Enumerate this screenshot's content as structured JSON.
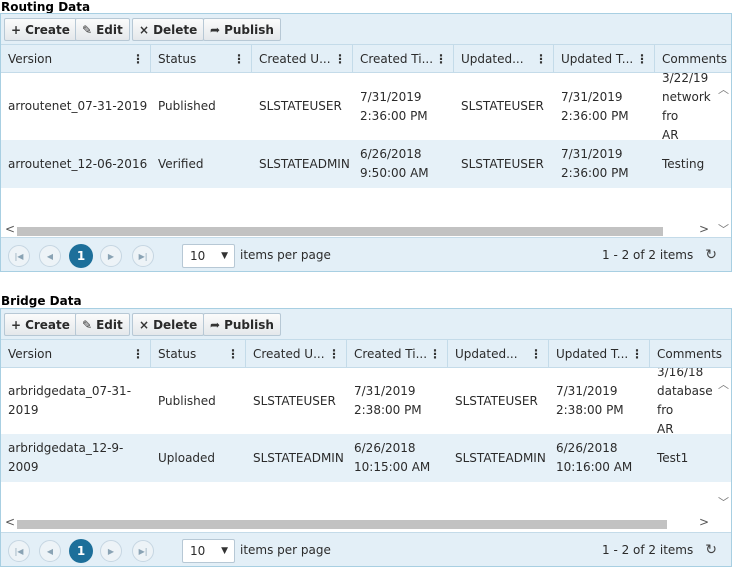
{
  "toolbar": {
    "create_label": "Create",
    "edit_label": "Edit",
    "delete_label": "Delete",
    "publish_label": "Publish"
  },
  "routing": {
    "title": "Routing Data",
    "columns": [
      "Version",
      "Status",
      "Created U...",
      "Created Ti...",
      "Updated...",
      "Updated T...",
      "Comments"
    ],
    "rows": [
      [
        "arroutenet_07-31-2019",
        "Published",
        "SLSTATEUSER",
        "7/31/2019\n2:36:00 PM",
        "SLSTATEUSER",
        "7/31/2019\n2:36:00 PM",
        "3/22/19\nnetwork fro\nAR"
      ],
      [
        "arroutenet_12-06-2016",
        "Verified",
        "SLSTATEADMIN",
        "6/26/2018\n9:50:00 AM",
        "SLSTATEUSER",
        "7/31/2019\n2:36:00 PM",
        "Testing"
      ]
    ],
    "pager": {
      "current_page": "1",
      "page_size": "10",
      "items_per_page_label": "items per page",
      "summary": "1 - 2 of 2 items"
    }
  },
  "bridge": {
    "title": "Bridge Data",
    "columns": [
      "Version",
      "Status",
      "Created U...",
      "Created Ti...",
      "Updated...",
      "Updated T...",
      "Comments"
    ],
    "rows": [
      [
        "arbridgedata_07-31-2019",
        "Published",
        "SLSTATEUSER",
        "7/31/2019\n2:38:00 PM",
        "SLSTATEUSER",
        "7/31/2019\n2:38:00 PM",
        "3/16/18\ndatabase fro\nAR"
      ],
      [
        "arbridgedata_12-9-2009",
        "Uploaded",
        "SLSTATEADMIN",
        "6/26/2018\n10:15:00 AM",
        "SLSTATEADMIN",
        "6/26/2018\n10:16:00 AM",
        "Test1"
      ]
    ],
    "pager": {
      "current_page": "1",
      "page_size": "10",
      "items_per_page_label": "items per page",
      "summary": "1 - 2 of 2 items"
    }
  }
}
